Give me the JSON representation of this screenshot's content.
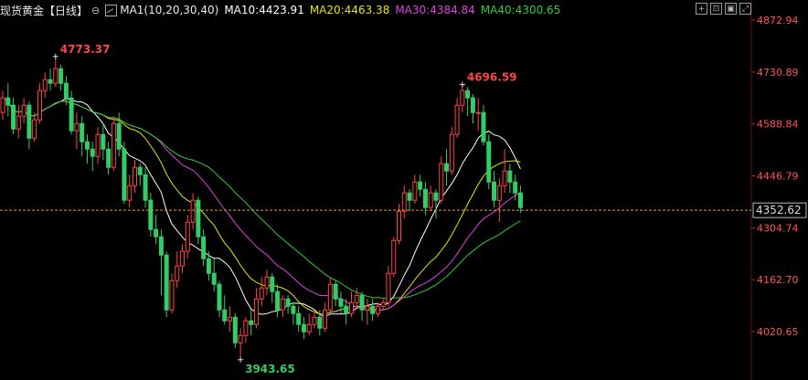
{
  "header": {
    "title": "现货黄金【日线】",
    "ma_label": "MA1(10,20,30,40)",
    "ma10": "MA10:4423.91",
    "ma20": "MA20:4463.38",
    "ma30": "MA30:4384.84",
    "ma40": "MA40:4300.65"
  },
  "colors": {
    "up": "#ff4444",
    "down": "#33cc66",
    "ma10": "#ffffff",
    "ma20": "#e6e600",
    "ma30": "#e040e0",
    "ma40": "#33cc33",
    "axis_text": "#ff5555",
    "background": "#000000"
  },
  "toolbar": {
    "icons": [
      "crosshair-icon",
      "zoom-icon",
      "window-icon",
      "expand-icon"
    ]
  },
  "chart_data": {
    "type": "candlestick",
    "y_ticks": [
      4872.94,
      4730.89,
      4588.84,
      4446.79,
      4304.74,
      4162.7,
      4020.65
    ],
    "y_tick_labels": [
      "4872.94",
      "4730.89",
      "4588.84",
      "4446.79",
      "4304.74",
      "4162.70",
      "4020.65"
    ],
    "ylim": [
      3925,
      4925
    ],
    "current_price": "4352.62",
    "current_value": 4352.62,
    "high_annotation": "4773.37",
    "high_value": 4773.37,
    "high_index": 10,
    "peak_annotation": "4696.59",
    "peak_value": 4696.59,
    "peak_index": 87,
    "low_annotation": "3943.65",
    "low_value": 3943.65,
    "low_index": 45,
    "candles": [
      [
        4620,
        4660,
        4600,
        4680
      ],
      [
        4660,
        4640,
        4610,
        4700
      ],
      [
        4640,
        4575,
        4560,
        4660
      ],
      [
        4575,
        4610,
        4550,
        4640
      ],
      [
        4610,
        4640,
        4590,
        4660
      ],
      [
        4640,
        4550,
        4520,
        4650
      ],
      [
        4550,
        4600,
        4540,
        4620
      ],
      [
        4600,
        4680,
        4590,
        4700
      ],
      [
        4680,
        4710,
        4660,
        4730
      ],
      [
        4710,
        4700,
        4680,
        4740
      ],
      [
        4700,
        4740,
        4690,
        4773.37
      ],
      [
        4740,
        4700,
        4680,
        4750
      ],
      [
        4700,
        4660,
        4640,
        4720
      ],
      [
        4660,
        4570,
        4560,
        4680
      ],
      [
        4570,
        4590,
        4520,
        4620
      ],
      [
        4590,
        4540,
        4500,
        4610
      ],
      [
        4540,
        4520,
        4480,
        4560
      ],
      [
        4520,
        4500,
        4460,
        4540
      ],
      [
        4500,
        4560,
        4480,
        4580
      ],
      [
        4560,
        4520,
        4490,
        4590
      ],
      [
        4520,
        4470,
        4450,
        4540
      ],
      [
        4470,
        4590,
        4460,
        4610
      ],
      [
        4590,
        4520,
        4500,
        4620
      ],
      [
        4520,
        4380,
        4370,
        4540
      ],
      [
        4380,
        4420,
        4360,
        4450
      ],
      [
        4420,
        4470,
        4400,
        4490
      ],
      [
        4470,
        4450,
        4420,
        4480
      ],
      [
        4450,
        4380,
        4360,
        4470
      ],
      [
        4380,
        4300,
        4280,
        4400
      ],
      [
        4300,
        4280,
        4260,
        4340
      ],
      [
        4280,
        4230,
        4120,
        4300
      ],
      [
        4230,
        4080,
        4060,
        4240
      ],
      [
        4080,
        4160,
        4070,
        4180
      ],
      [
        4160,
        4200,
        4140,
        4240
      ],
      [
        4200,
        4240,
        4180,
        4260
      ],
      [
        4240,
        4320,
        4220,
        4340
      ],
      [
        4320,
        4380,
        4300,
        4400
      ],
      [
        4380,
        4280,
        4260,
        4390
      ],
      [
        4280,
        4220,
        4200,
        4300
      ],
      [
        4220,
        4180,
        4160,
        4240
      ],
      [
        4180,
        4150,
        4130,
        4220
      ],
      [
        4150,
        4080,
        4060,
        4160
      ],
      [
        4080,
        4050,
        4040,
        4120
      ],
      [
        4050,
        4060,
        4020,
        4090
      ],
      [
        4060,
        3990,
        3975,
        4070
      ],
      [
        3990,
        4010,
        3943.65,
        4030
      ],
      [
        4010,
        4050,
        3990,
        4060
      ],
      [
        4050,
        4040,
        4010,
        4080
      ],
      [
        4040,
        4110,
        4030,
        4140
      ],
      [
        4110,
        4140,
        4090,
        4170
      ],
      [
        4140,
        4170,
        4120,
        4190
      ],
      [
        4170,
        4130,
        4100,
        4180
      ],
      [
        4130,
        4080,
        4060,
        4150
      ],
      [
        4080,
        4110,
        4060,
        4120
      ],
      [
        4110,
        4090,
        4070,
        4120
      ],
      [
        4090,
        4070,
        4040,
        4100
      ],
      [
        4070,
        4040,
        4020,
        4090
      ],
      [
        4040,
        4020,
        4000,
        4060
      ],
      [
        4020,
        4040,
        4010,
        4070
      ],
      [
        4040,
        4060,
        4030,
        4080
      ],
      [
        4060,
        4030,
        4010,
        4080
      ],
      [
        4030,
        4080,
        4020,
        4100
      ],
      [
        4080,
        4150,
        4070,
        4170
      ],
      [
        4150,
        4110,
        4090,
        4160
      ],
      [
        4110,
        4090,
        4070,
        4130
      ],
      [
        4090,
        4070,
        4040,
        4110
      ],
      [
        4070,
        4100,
        4060,
        4130
      ],
      [
        4100,
        4120,
        4090,
        4140
      ],
      [
        4120,
        4080,
        4050,
        4130
      ],
      [
        4080,
        4090,
        4040,
        4110
      ],
      [
        4090,
        4070,
        4050,
        4110
      ],
      [
        4070,
        4090,
        4060,
        4100
      ],
      [
        4090,
        4100,
        4080,
        4110
      ],
      [
        4100,
        4180,
        4090,
        4200
      ],
      [
        4180,
        4270,
        4170,
        4280
      ],
      [
        4270,
        4350,
        4260,
        4370
      ],
      [
        4350,
        4400,
        4330,
        4420
      ],
      [
        4400,
        4380,
        4350,
        4410
      ],
      [
        4380,
        4430,
        4370,
        4450
      ],
      [
        4430,
        4410,
        4390,
        4450
      ],
      [
        4410,
        4360,
        4340,
        4430
      ],
      [
        4360,
        4400,
        4350,
        4420
      ],
      [
        4400,
        4380,
        4330,
        4410
      ],
      [
        4380,
        4480,
        4370,
        4500
      ],
      [
        4480,
        4460,
        4420,
        4520
      ],
      [
        4460,
        4560,
        4450,
        4580
      ],
      [
        4560,
        4640,
        4550,
        4660
      ],
      [
        4640,
        4680,
        4620,
        4696.59
      ],
      [
        4680,
        4660,
        4610,
        4690
      ],
      [
        4660,
        4620,
        4590,
        4670
      ],
      [
        4620,
        4620,
        4570,
        4660
      ],
      [
        4620,
        4540,
        4530,
        4640
      ],
      [
        4540,
        4430,
        4410,
        4560
      ],
      [
        4430,
        4380,
        4360,
        4460
      ],
      [
        4380,
        4420,
        4320,
        4440
      ],
      [
        4420,
        4460,
        4400,
        4520
      ],
      [
        4460,
        4430,
        4400,
        4480
      ],
      [
        4430,
        4400,
        4380,
        4450
      ],
      [
        4400,
        4360,
        4345,
        4420
      ]
    ]
  }
}
